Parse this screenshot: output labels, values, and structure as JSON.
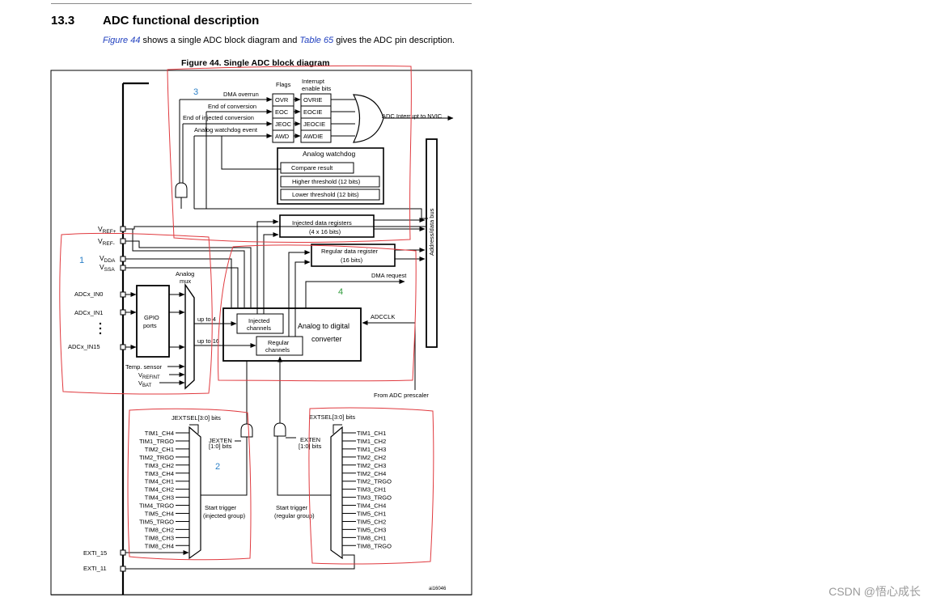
{
  "header": {
    "section_number": "13.3",
    "section_title": "ADC functional description",
    "intro_link1": "Figure 44",
    "intro_mid": " shows a single ADC block diagram and ",
    "intro_link2": "Table 65",
    "intro_end": " gives the ADC pin description."
  },
  "figure": {
    "caption": "Figure 44. Single ADC block diagram",
    "id_label": "ai16046",
    "flags": {
      "title": "Flags",
      "items": [
        "OVR",
        "EOC",
        "JEOC",
        "AWD"
      ],
      "sources": [
        "DMA overrun",
        "End of conversion",
        "End of injected conversion",
        "Analog watchdog event"
      ]
    },
    "interrupt": {
      "title_line1": "Interrupt",
      "title_line2": "enable bits",
      "items": [
        "OVRIE",
        "EOCIE",
        "JEOCIE",
        "AWDIE"
      ],
      "output": "ADC Interrupt to NVIC"
    },
    "watchdog": {
      "title": "Analog watchdog",
      "items": [
        "Compare result",
        "Higher threshold (12 bits)",
        "Lower threshold (12 bits)"
      ]
    },
    "injected_regs": {
      "line1": "Injected data registers",
      "line2": "(4 x 16 bits)"
    },
    "regular_reg": {
      "line1": "Regular data register",
      "line2": "(16 bits)"
    },
    "bus_label": "Address/data bus",
    "dma_request": "DMA request",
    "adcclk": "ADCCLK",
    "from_prescaler": "From ADC prescaler",
    "converter": {
      "line1": "Analog to digital",
      "line2": "converter",
      "injected_l1": "Injected",
      "injected_l2": "channels",
      "regular_l1": "Regular",
      "regular_l2": "channels"
    },
    "pins": {
      "vref_plus": {
        "main": "V",
        "sub": "REF+"
      },
      "vref_minus": {
        "main": "V",
        "sub": "REF-"
      },
      "vdda": {
        "main": "V",
        "sub": "DDA"
      },
      "vssa": {
        "main": "V",
        "sub": "SSA"
      },
      "inputs": [
        "ADCx_IN0",
        "ADCx_IN1",
        "ADCx_IN15"
      ]
    },
    "gpio": {
      "line1": "GPIO",
      "line2": "ports"
    },
    "mux": {
      "line1": "Analog",
      "line2": "mux",
      "up_to_4": "up to 4",
      "up_to_16": "up to 16"
    },
    "internal": {
      "temp": "Temp. sensor",
      "vrefint": {
        "main": "V",
        "sub": "REFINT"
      },
      "vbat": {
        "main": "V",
        "sub": "BAT"
      }
    },
    "injected_trigger": {
      "sel": "JEXTSEL[3:0] bits",
      "en_l1": "JEXTEN",
      "en_l2": "[1:0] bits",
      "start_l1": "Start trigger",
      "start_l2": "(injected group)",
      "sources": [
        "TIM1_CH4",
        "TIM1_TRGO",
        "TIM2_CH1",
        "TIM2_TRGO",
        "TIM3_CH2",
        "TIM3_CH4",
        "TIM4_CH1",
        "TIM4_CH2",
        "TIM4_CH3",
        "TIM4_TRGO",
        "TIM5_CH4",
        "TIM5_TRGO",
        "TIM8_CH2",
        "TIM8_CH3",
        "TIM8_CH4"
      ]
    },
    "regular_trigger": {
      "sel": "EXTSEL[3:0] bits",
      "en_l1": "EXTEN",
      "en_l2": "[1:0] bits",
      "start_l1": "Start trigger",
      "start_l2": "(regular group)",
      "sources": [
        "TIM1_CH1",
        "TIM1_CH2",
        "TIM1_CH3",
        "TIM2_CH2",
        "TIM2_CH3",
        "TIM2_CH4",
        "TIM2_TRGO",
        "TIM3_CH1",
        "TIM3_TRGO",
        "TIM4_CH4",
        "TIM5_CH1",
        "TIM5_CH2",
        "TIM5_CH3",
        "TIM8_CH1",
        "TIM8_TRGO"
      ]
    },
    "exti": [
      "EXTI_15",
      "EXTI_11"
    ],
    "annotations": [
      "1",
      "2",
      "3",
      "4"
    ]
  },
  "watermark": "CSDN @悟心成长",
  "colors": {
    "annotation_red": "#e0393e",
    "number_blue": "#2a7fc7",
    "number_green": "#2e9a3a",
    "link_blue": "#1f3fbf"
  }
}
